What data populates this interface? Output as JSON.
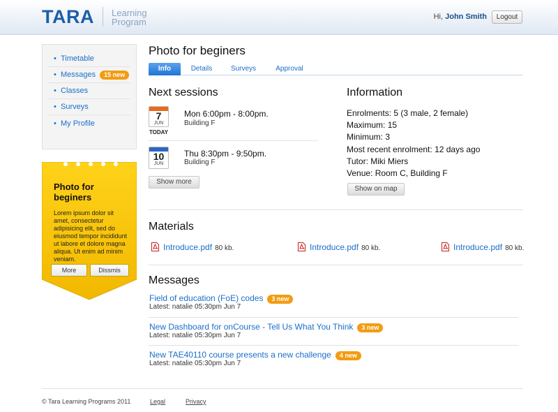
{
  "header": {
    "logo": "TARA",
    "logo_sub_line1": "Learning",
    "logo_sub_line2": "Program",
    "greeting": "Hi,",
    "user_name": "John Smith",
    "logout_label": "Logout"
  },
  "sidebar": {
    "items": [
      {
        "label": "Timetable"
      },
      {
        "label": "Messages",
        "badge": "15 new"
      },
      {
        "label": "Classes"
      },
      {
        "label": "Surveys"
      },
      {
        "label": "My Profile"
      }
    ]
  },
  "promo": {
    "title": "Photo for beginers",
    "text": "Lorem ipsum dolor sit amet, consectetur adipisicing elit, sed do eiusmod tempor incididunt ut labore et dolore magna aliqua. Ut enim ad minim veniam.",
    "more_label": "More",
    "dismiss_label": "Dissmis"
  },
  "main": {
    "title": "Photo for beginers",
    "tabs": [
      {
        "label": "Info",
        "active": true
      },
      {
        "label": "Details"
      },
      {
        "label": "Surveys"
      },
      {
        "label": "Approval"
      }
    ],
    "sessions_heading": "Next sessions",
    "sessions": [
      {
        "day": "7",
        "month": "JUN",
        "today": "TODAY",
        "time": "Mon 6:00pm - 8:00pm.",
        "place": "Building F"
      },
      {
        "day": "10",
        "month": "JUN",
        "today": "",
        "time": "Thu 8:30pm - 9:50pm.",
        "place": "Building F"
      }
    ],
    "show_more_label": "Show more",
    "information_heading": "Information",
    "information": [
      {
        "label": "Enrolments:",
        "value": "5 (3 male, 2 female)"
      },
      {
        "label": "Maximum:",
        "value": "15"
      },
      {
        "label": "Minimum:",
        "value": "3"
      },
      {
        "label": "Most recent enrolment:",
        "value": "12 days ago"
      },
      {
        "label": "Tutor:",
        "value": "Miki Miers"
      },
      {
        "label": "Venue:",
        "value": "Room C, Building F"
      }
    ],
    "show_on_map_label": "Show on map",
    "materials_heading": "Materials",
    "materials": [
      {
        "name": "Introduce.pdf",
        "size": "80 kb."
      },
      {
        "name": "Introduce.pdf",
        "size": "80 kb."
      },
      {
        "name": "Introduce.pdf",
        "size": "80 kb."
      }
    ],
    "messages_heading": "Messages",
    "messages": [
      {
        "title": "Field of education (FoE) codes",
        "badge": "3 new",
        "meta": "Latest: natalie 05:30pm Jun 7"
      },
      {
        "title": "New Dashboard for onCourse - Tell Us What You Think",
        "badge": "3 new",
        "meta": "Latest: natalie 05:30pm Jun 7"
      },
      {
        "title": "New TAE40110 course presents a new challenge",
        "badge": "4 new",
        "meta": "Latest: natalie 05:30pm Jun 7"
      }
    ]
  },
  "footer": {
    "copyright": "© Tara Learning Programs 2011",
    "legal_label": "Legal",
    "privacy_label": "Privacy"
  },
  "colors": {
    "accent_blue": "#1a6fc9",
    "brand_blue": "#1c5fa8",
    "badge_orange": "#f39c12",
    "promo_yellow": "#f7c300"
  }
}
